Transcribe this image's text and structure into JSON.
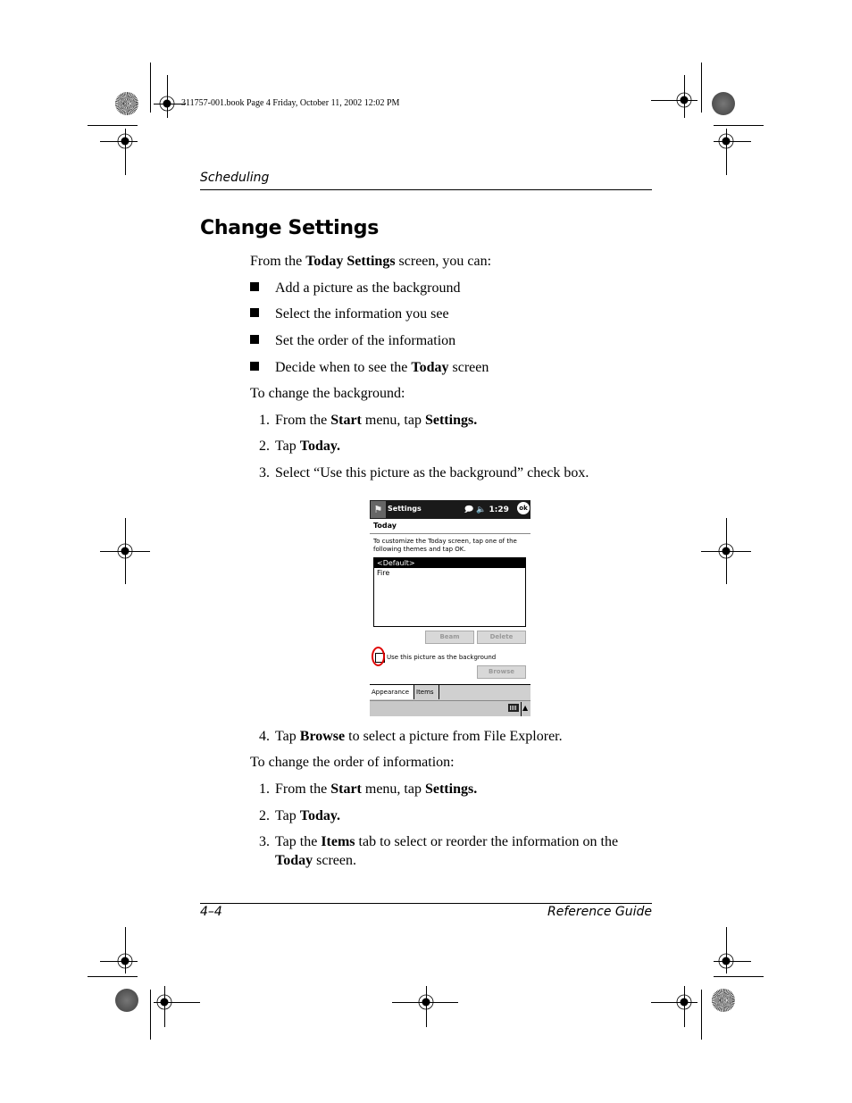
{
  "slug": "311757-001.book  Page 4  Friday, October 11, 2002  12:02 PM",
  "running_head": "Scheduling",
  "heading": "Change Settings",
  "intro": {
    "pre": "From the ",
    "bold": "Today Settings",
    "post": " screen, you can:"
  },
  "bullets": [
    {
      "text": "Add a picture as the background"
    },
    {
      "text": "Select the information you see"
    },
    {
      "text": "Set the order of the information"
    },
    {
      "pre": "Decide when to see the ",
      "bold": "Today",
      "post": " screen"
    }
  ],
  "section1": {
    "lead": "To change the background:",
    "steps": [
      {
        "num": "1.",
        "pre": "From the ",
        "b1": "Start",
        "mid": " menu, tap ",
        "b2": "Settings."
      },
      {
        "num": "2.",
        "pre": "Tap ",
        "b1": "Today."
      },
      {
        "num": "3.",
        "pre": "Select “Use this picture as the background” check box."
      }
    ],
    "step4": {
      "num": "4.",
      "pre": "Tap ",
      "b1": "Browse",
      "post": " to select a picture from File Explorer."
    }
  },
  "section2": {
    "lead": "To change the order of information:",
    "steps": [
      {
        "num": "1.",
        "pre": "From the ",
        "b1": "Start",
        "mid": " menu, tap ",
        "b2": "Settings."
      },
      {
        "num": "2.",
        "pre": "Tap ",
        "b1": "Today."
      },
      {
        "num": "3.",
        "pre": "Tap the ",
        "b1": "Items",
        "post": " tab to select or reorder the information on the",
        "line2_bold": "Today",
        "line2_post": " screen."
      }
    ]
  },
  "screenshot": {
    "app_title": "Settings",
    "start_icon": "windows-flag-icon",
    "status_icons": [
      "connectivity-icon",
      "speaker-icon"
    ],
    "time": "1:29",
    "ok_label": "ok",
    "page_title": "Today",
    "description": "To customize the Today screen, tap one of the following themes and tap OK.",
    "themes": [
      {
        "label": "<Default>",
        "selected": true
      },
      {
        "label": "Fire",
        "selected": false
      }
    ],
    "beam_label": "Beam",
    "delete_label": "Delete",
    "checkbox_label": "Use this picture as the background",
    "checkbox_checked": false,
    "browse_label": "Browse",
    "tabs": [
      {
        "label": "Appearance",
        "active": true
      },
      {
        "label": "Items",
        "active": false
      }
    ],
    "highlight_color": "#e00000"
  },
  "footer": {
    "page_number": "4–4",
    "guide_title": "Reference Guide"
  }
}
